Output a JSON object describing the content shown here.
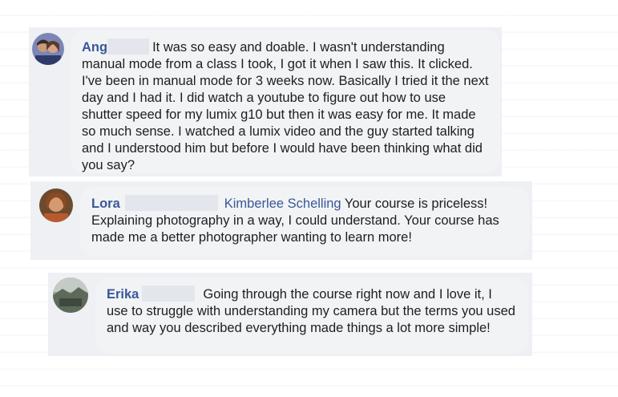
{
  "comments": [
    {
      "name": "Ang",
      "tag": "",
      "text": "It was so easy and doable. I wasn't understanding manual mode from a class I took, I got it when I saw this. It clicked. I've been in manual mode for 3 weeks now. Basically I tried it the next day and I had it. I did watch a youtube to figure out how to use shutter speed for my lumix g10 but then it was easy for me. It made so much sense. I watched a lumix video and the guy started talking and I understood him but before I would have been thinking what did you say?",
      "avatar_icon": "profile-photo-couple"
    },
    {
      "name": "Lora",
      "tag": "Kimberlee Schelling",
      "text": "Your course is priceless! Explaining photography in a way, I could understand. Your course has made me a better photographer wanting to learn more!",
      "avatar_icon": "profile-photo-woman"
    },
    {
      "name": "Erika",
      "tag": "",
      "text": "Going through the course right now and I love it, I use to struggle with understanding my camera but the terms you used and way you described everything made things a lot more simple!",
      "avatar_icon": "profile-photo-landscape"
    }
  ],
  "colors": {
    "name": "#385898",
    "bubble": "#f2f3f5",
    "text": "#1c1e21"
  }
}
